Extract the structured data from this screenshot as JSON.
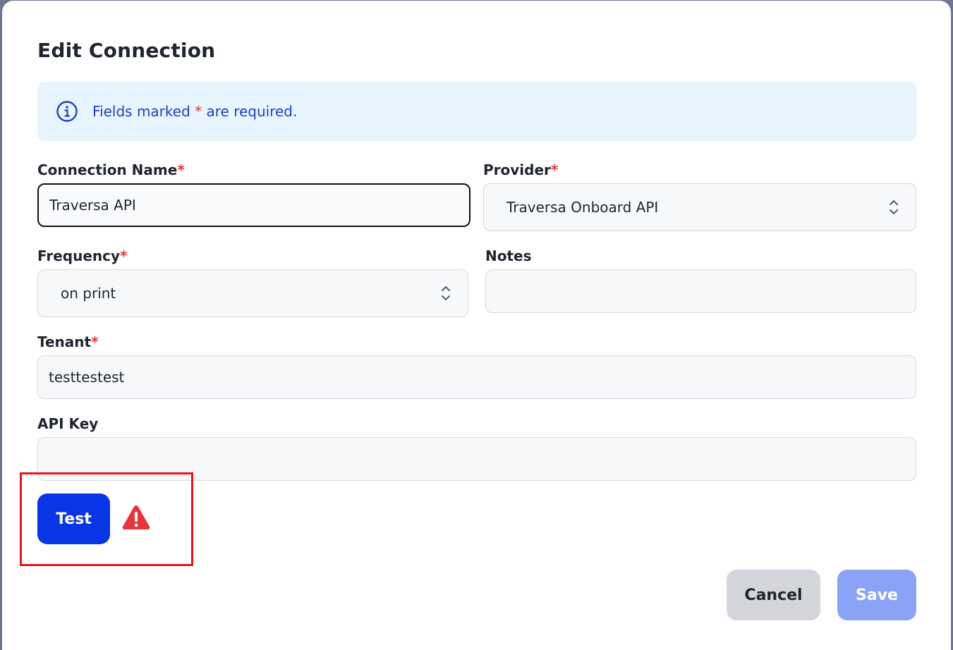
{
  "dialog": {
    "title": "Edit Connection",
    "info": {
      "text_before": "Fields marked",
      "required_mark": "*",
      "text_after": "are required."
    }
  },
  "form": {
    "connection_name": {
      "label": "Connection Name",
      "required_mark": "*",
      "value": "Traversa API"
    },
    "provider": {
      "label": "Provider",
      "required_mark": "*",
      "value": "Traversa Onboard API"
    },
    "frequency": {
      "label": "Frequency",
      "required_mark": "*",
      "value": "on print"
    },
    "notes": {
      "label": "Notes",
      "value": ""
    },
    "tenant": {
      "label": "Tenant",
      "required_mark": "*",
      "value": "testtestest"
    },
    "api_key": {
      "label": "API Key",
      "value": ""
    }
  },
  "actions": {
    "test_label": "Test",
    "cancel_label": "Cancel",
    "save_label": "Save"
  },
  "colors": {
    "primary": "#0836e4",
    "primary_disabled": "#8aa3f6",
    "required": "#e0353c",
    "info_bg": "#e8f4fe",
    "info_text": "#1d40c2",
    "warning": "#e5363d",
    "highlight": "#e8141c"
  },
  "icons": {
    "info": "info-circle-icon",
    "select": "chevron-up-down-icon",
    "warning": "warning-triangle-icon"
  }
}
